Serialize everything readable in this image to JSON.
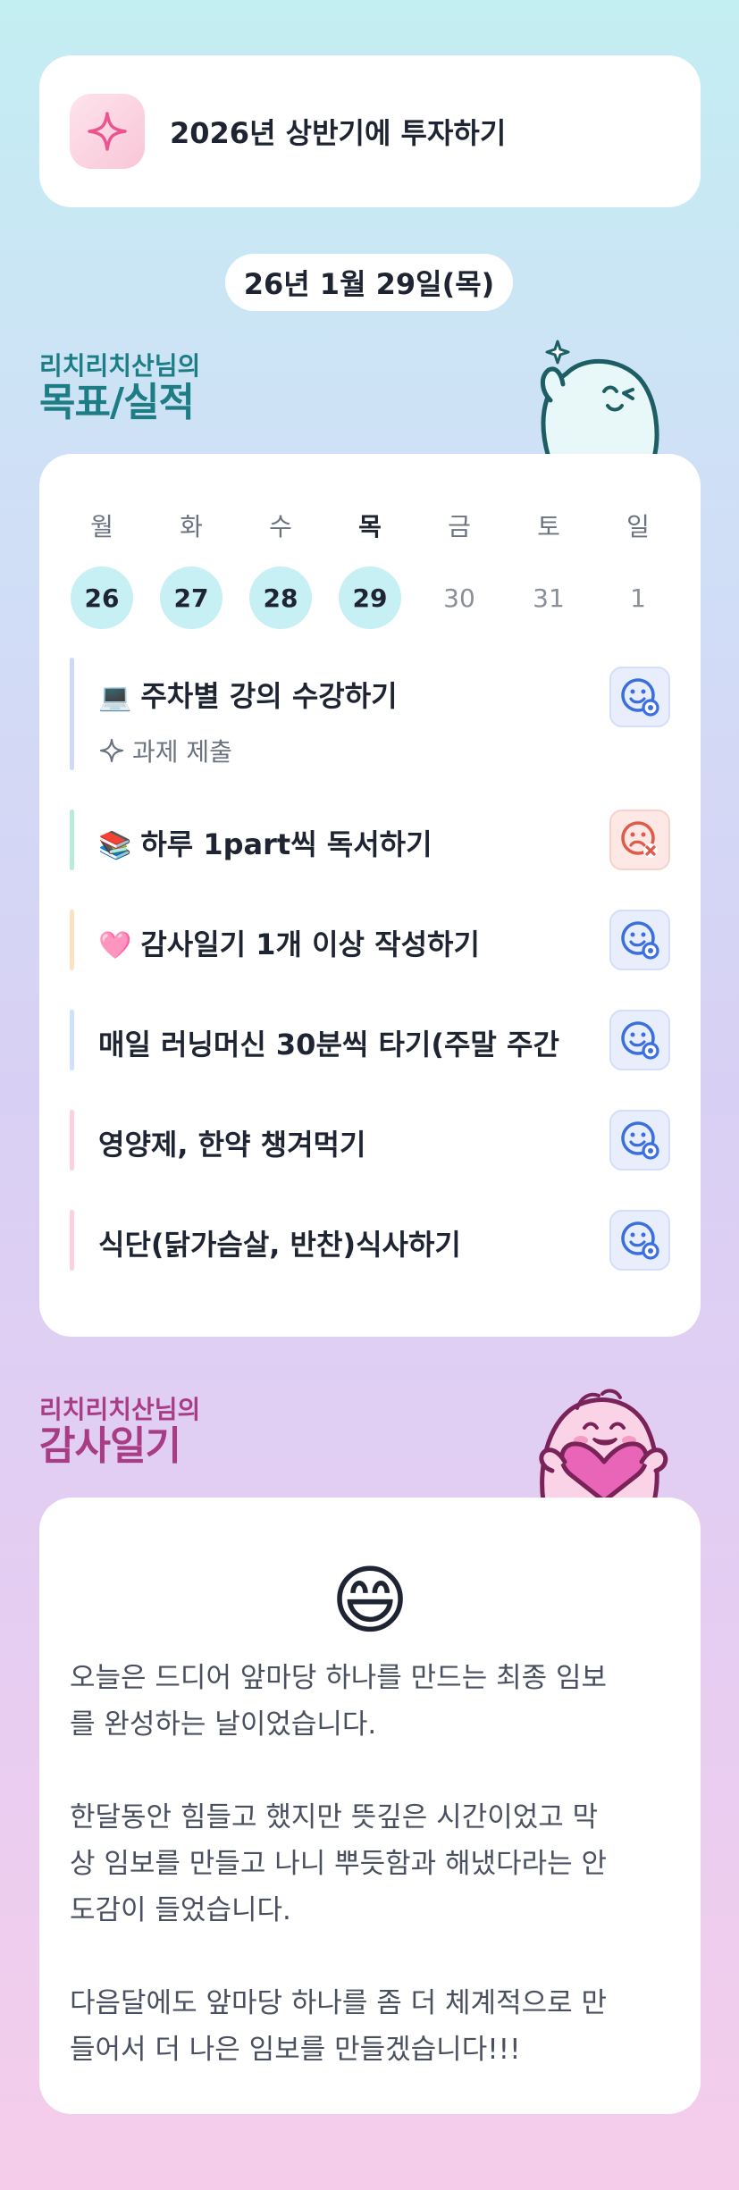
{
  "goal": {
    "title": "2026년 상반기에 투자하기",
    "icon": "sparkle-icon",
    "icon_color": "#e8558f"
  },
  "date": "26년 1월 29일(목)",
  "goals_section": {
    "subtitle": "리치리치산님의",
    "title": "목표/실적"
  },
  "calendar": {
    "days": [
      {
        "name": "월",
        "date": "26",
        "done": true
      },
      {
        "name": "화",
        "date": "27",
        "done": true
      },
      {
        "name": "수",
        "date": "28",
        "done": true
      },
      {
        "name": "목",
        "date": "29",
        "done": true,
        "today": true
      },
      {
        "name": "금",
        "date": "30",
        "done": false
      },
      {
        "name": "토",
        "date": "31",
        "done": false
      },
      {
        "name": "일",
        "date": "1",
        "done": false
      }
    ]
  },
  "tasks": [
    {
      "emoji": "💻",
      "label": "주차별 강의 수강하기",
      "sub": "과제 제출",
      "bar_color": "#cfd8f5",
      "status": "good"
    },
    {
      "emoji": "📚",
      "label": "하루 1part씩 독서하기",
      "bar_color": "#b6ecd8",
      "status": "bad"
    },
    {
      "emoji": "🩷",
      "label": "감사일기 1개 이상 작성하기",
      "bar_color": "#fbe2c0",
      "status": "good"
    },
    {
      "emoji": "",
      "label": "매일 러닝머신 30분씩 타기(주말 주간",
      "bar_color": "#cfe0fb",
      "status": "good"
    },
    {
      "emoji": "",
      "label": "영양제, 한약 챙겨먹기",
      "bar_color": "#fbd0e2",
      "status": "good"
    },
    {
      "emoji": "",
      "label": "식단(닭가슴살, 반찬)식사하기",
      "bar_color": "#fbd0e2",
      "status": "good"
    }
  ],
  "diary_section": {
    "subtitle": "리치리치산님의",
    "title": "감사일기"
  },
  "diary": {
    "emoji": "😄",
    "text": "오늘은 드디어 앞마당 하나를 만드는 최종 임보\n를 완성하는 날이었습니다.\n\n한달동안 힘들고 했지만 뜻깊은 시간이었고 막\n상 임보를 만들고 나니 뿌듯함과 해냈다라는 안\n도감이 들었습니다.\n\n다음달에도 앞마당 하나를 좀 더 체계적으로 만\n들어서 더 나은 임보를 만들겠습니다!!!"
  },
  "colors": {
    "teal": "#1d7d84",
    "magenta": "#a83d86",
    "good_face": "#3b6fe0",
    "bad_face": "#e05a4a",
    "done_day": "#c7f0f4"
  }
}
